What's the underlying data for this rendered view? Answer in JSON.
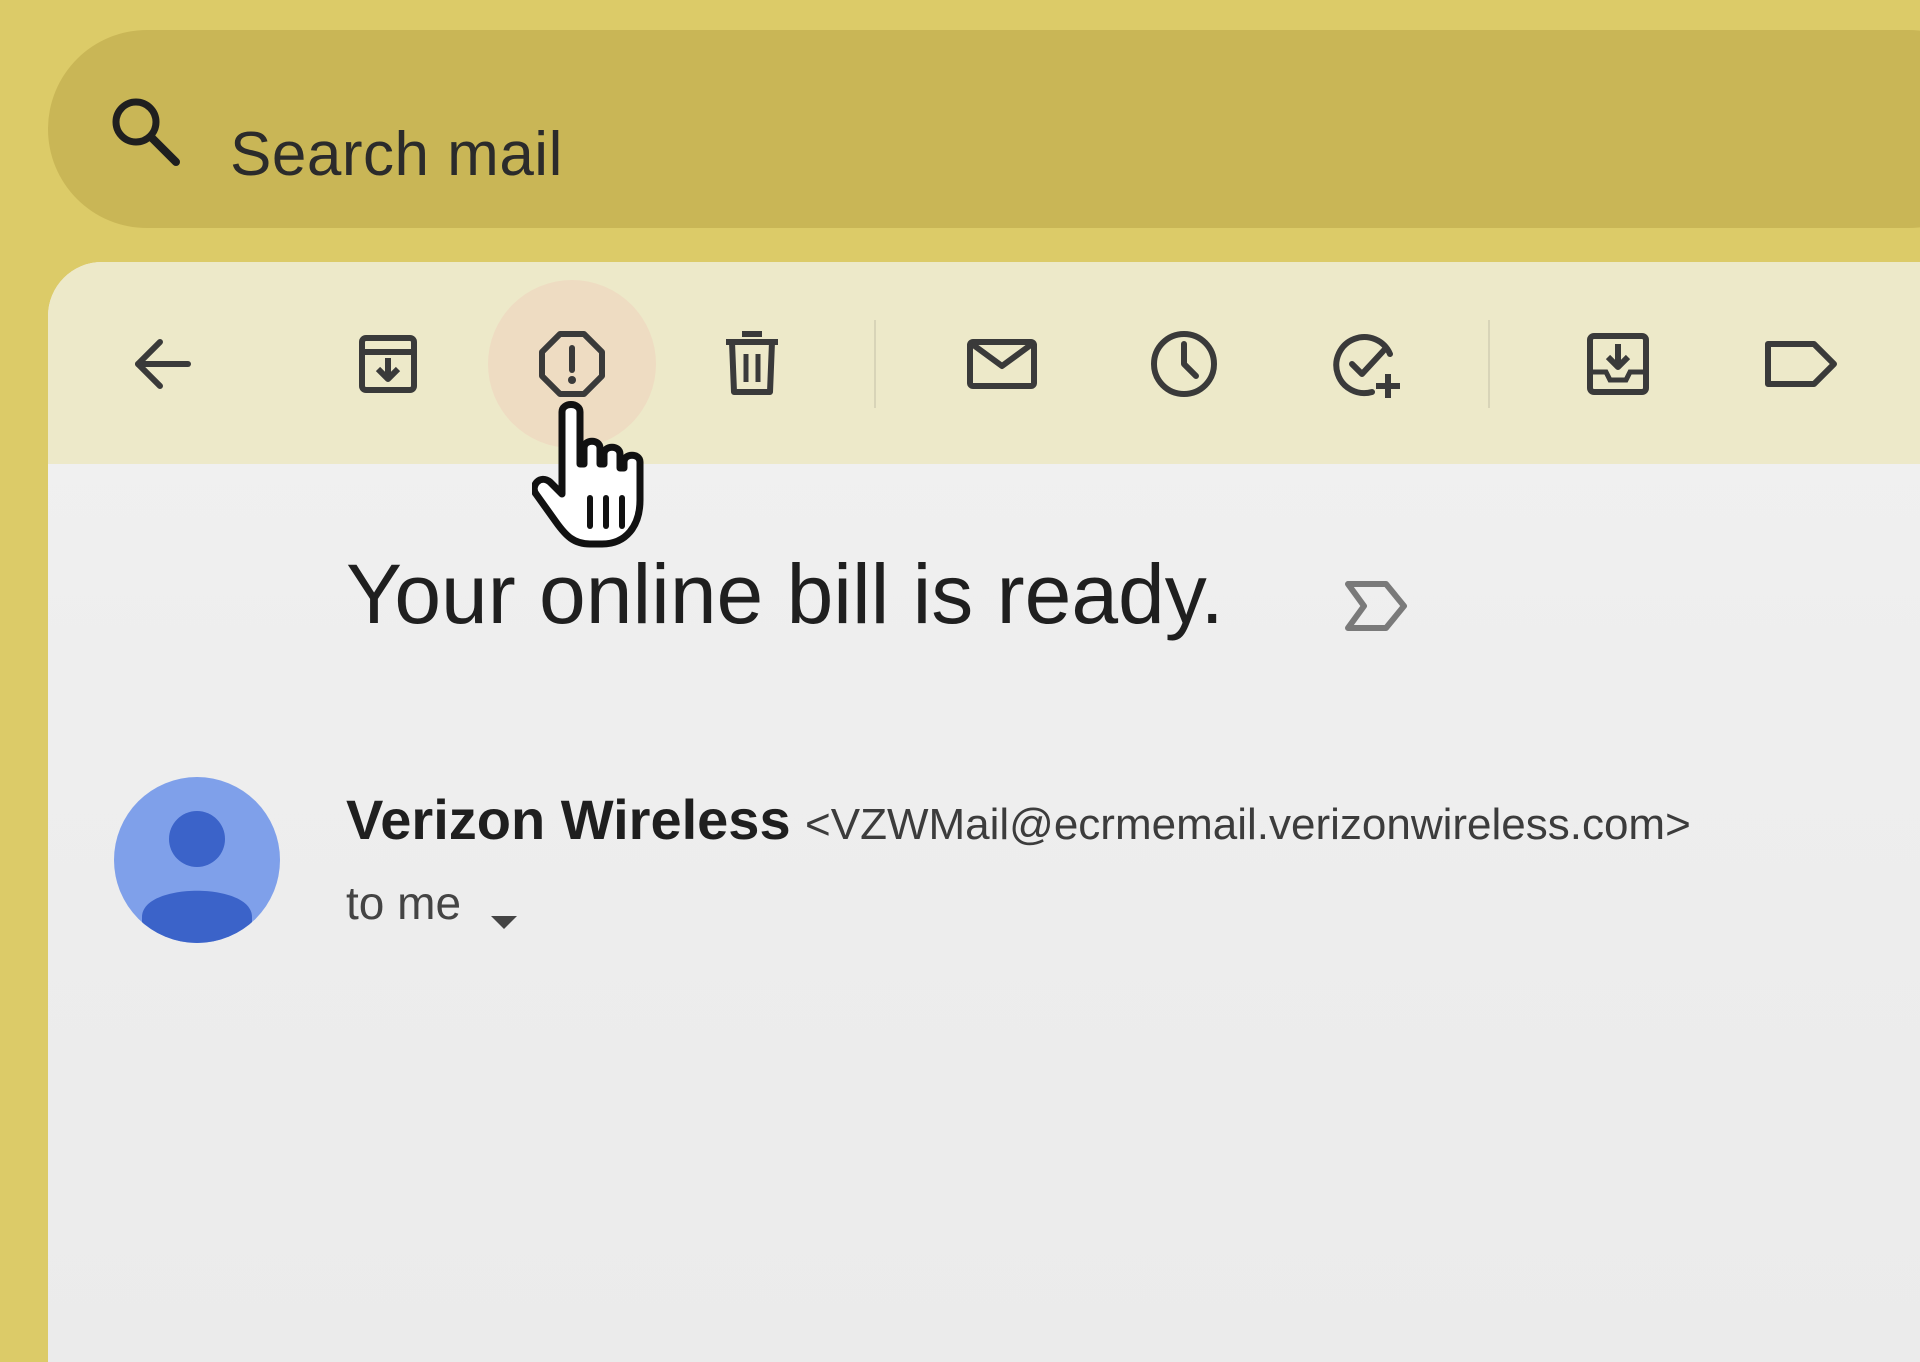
{
  "search": {
    "placeholder": "Search mail"
  },
  "toolbar": {
    "buttons": [
      {
        "name": "back-button",
        "icon": "arrow-back-icon"
      },
      {
        "name": "archive-button",
        "icon": "archive-icon"
      },
      {
        "name": "report-spam-button",
        "icon": "report-spam-icon",
        "state": "hover"
      },
      {
        "name": "delete-button",
        "icon": "trash-icon"
      },
      {
        "name": "mark-unread-button",
        "icon": "mail-icon"
      },
      {
        "name": "snooze-button",
        "icon": "clock-icon"
      },
      {
        "name": "add-to-tasks-button",
        "icon": "add-task-icon"
      },
      {
        "name": "move-to-button",
        "icon": "move-to-inbox-icon"
      },
      {
        "name": "labels-button",
        "icon": "label-icon"
      }
    ]
  },
  "email": {
    "subject": "Your online bill is ready.",
    "sender_name": "Verizon Wireless",
    "sender_email": "<VZWMail@ecrmemail.verizonwireless.com>",
    "recipient": "to me"
  },
  "colors": {
    "background": "#dccb68",
    "search_bar": "#c9b656",
    "toolbar": "#ede9c9",
    "hover_highlight": "#eedcc2",
    "avatar": "#7fa0ea",
    "avatar_figure": "#3b63c9"
  }
}
